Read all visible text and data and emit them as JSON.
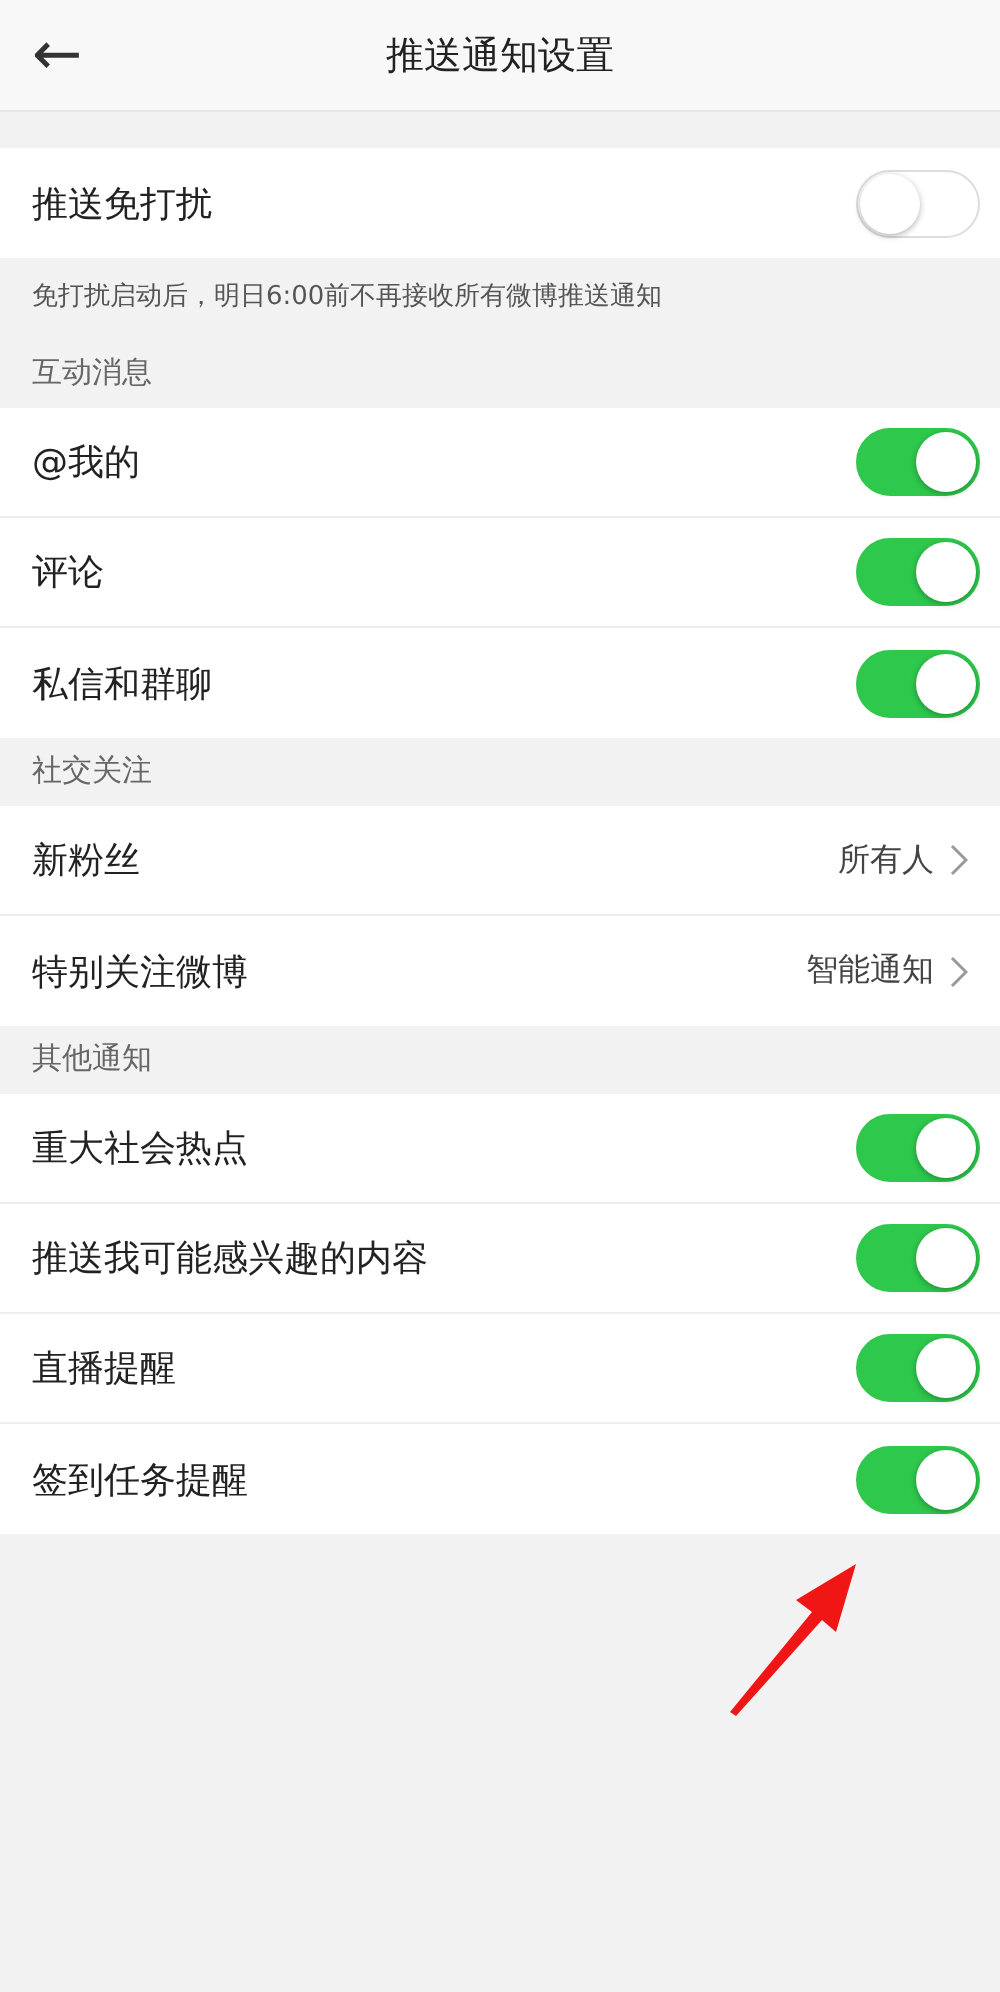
{
  "header": {
    "back": "←",
    "title": "推送通知设置"
  },
  "sections": [
    {
      "rows": [
        {
          "kind": "toggle",
          "label": "推送免打扰",
          "on": false
        }
      ],
      "note": "免打扰启动后，明日6:00前不再接收所有微博推送通知"
    },
    {
      "header": "互动消息",
      "rows": [
        {
          "kind": "toggle",
          "label": "@我的",
          "on": true
        },
        {
          "kind": "toggle",
          "label": "评论",
          "on": true
        },
        {
          "kind": "toggle",
          "label": "私信和群聊",
          "on": true
        }
      ]
    },
    {
      "header": "社交关注",
      "rows": [
        {
          "kind": "link",
          "label": "新粉丝",
          "value": "所有人"
        },
        {
          "kind": "link",
          "label": "特别关注微博",
          "value": "智能通知"
        }
      ]
    },
    {
      "header": "其他通知",
      "rows": [
        {
          "kind": "toggle",
          "label": "重大社会热点",
          "on": true
        },
        {
          "kind": "toggle",
          "label": "推送我可能感兴趣的内容",
          "on": true
        },
        {
          "kind": "toggle",
          "label": "直播提醒",
          "on": true
        },
        {
          "kind": "toggle",
          "label": "签到任务提醒",
          "on": true
        }
      ]
    }
  ]
}
